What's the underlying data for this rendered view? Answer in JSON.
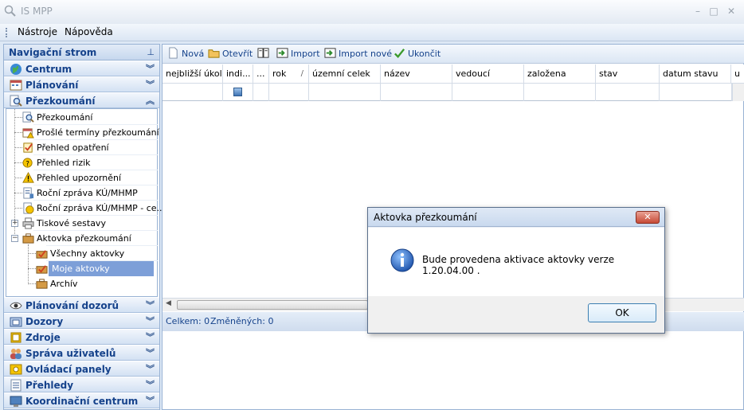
{
  "window": {
    "title": "IS MPP",
    "minimize": "–",
    "maximize": "□",
    "close": "✕"
  },
  "menu": [
    "Nástroje",
    "Nápověda"
  ],
  "nav": {
    "title": "Navigační strom",
    "pin": "ᵖ",
    "groups_top": [
      {
        "label": "Centrum",
        "icon": "globe-icon",
        "chev": "︾"
      },
      {
        "label": "Plánování",
        "icon": "calendar-icon",
        "chev": "︾"
      },
      {
        "label": "Přezkoumání",
        "icon": "magnifier-icon",
        "chev": "︽"
      }
    ],
    "tree": [
      {
        "label": "Přezkoumání",
        "icon": "magnifier-doc-icon"
      },
      {
        "label": "Prošlé termíny přezkoumání",
        "icon": "calendar-warning-icon"
      },
      {
        "label": "Přehled opatření",
        "icon": "checklist-icon"
      },
      {
        "label": "Přehled rizik",
        "icon": "warning-shield-icon"
      },
      {
        "label": "Přehled upozornění",
        "icon": "warning-triangle-icon"
      },
      {
        "label": "Roční zpráva KÚ/MHMP",
        "icon": "report-icon"
      },
      {
        "label": "Roční zpráva KÚ/MHMP - ce...",
        "icon": "report-shield-icon"
      },
      {
        "label": "Tiskové sestavy",
        "icon": "printer-icon"
      },
      {
        "label": "Aktovka přezkoumání",
        "icon": "briefcase-icon"
      },
      {
        "label": "Všechny aktovky",
        "icon": "briefcase-check-icon"
      },
      {
        "label": "Moje aktovky",
        "icon": "briefcase-user-icon"
      },
      {
        "label": "Archív",
        "icon": "archive-icon"
      }
    ],
    "groups_bottom": [
      {
        "label": "Plánování dozorů",
        "icon": "eye-icon",
        "chev": "︾"
      },
      {
        "label": "Dozory",
        "icon": "folder-icon",
        "chev": "︾"
      },
      {
        "label": "Zdroje",
        "icon": "book-icon",
        "chev": "︾"
      },
      {
        "label": "Správa uživatelů",
        "icon": "users-icon",
        "chev": "︾"
      },
      {
        "label": "Ovládací panely",
        "icon": "panel-icon",
        "chev": "︾"
      },
      {
        "label": "Přehledy",
        "icon": "list-icon",
        "chev": "︾"
      },
      {
        "label": "Koordinační centrum",
        "icon": "network-icon",
        "chev": "︾"
      }
    ]
  },
  "toolbar": {
    "new": "Nová",
    "open": "Otevřít",
    "import": "Import",
    "import_new": "Import nové",
    "finish": "Ukončit"
  },
  "grid": {
    "columns": [
      "nejbližší úkol",
      "indi...",
      "...",
      "rok",
      "územní celek",
      "název",
      "vedoucí",
      "založena",
      "stav",
      "datum stavu",
      "u"
    ],
    "sort_marks": {
      "indi": "/",
      "rok": "/"
    }
  },
  "status": {
    "total": "Celkem: 0",
    "changed": "Změněných: 0"
  },
  "dialog": {
    "title": "Aktovka přezkoumání",
    "close": "✕",
    "message": "Bude provedena aktivace aktovky verze 1.20.04.00 .",
    "ok": "OK"
  },
  "colors": {
    "accent": "#15428b",
    "selection": "#7d9fd8",
    "border": "#98b2d4"
  }
}
